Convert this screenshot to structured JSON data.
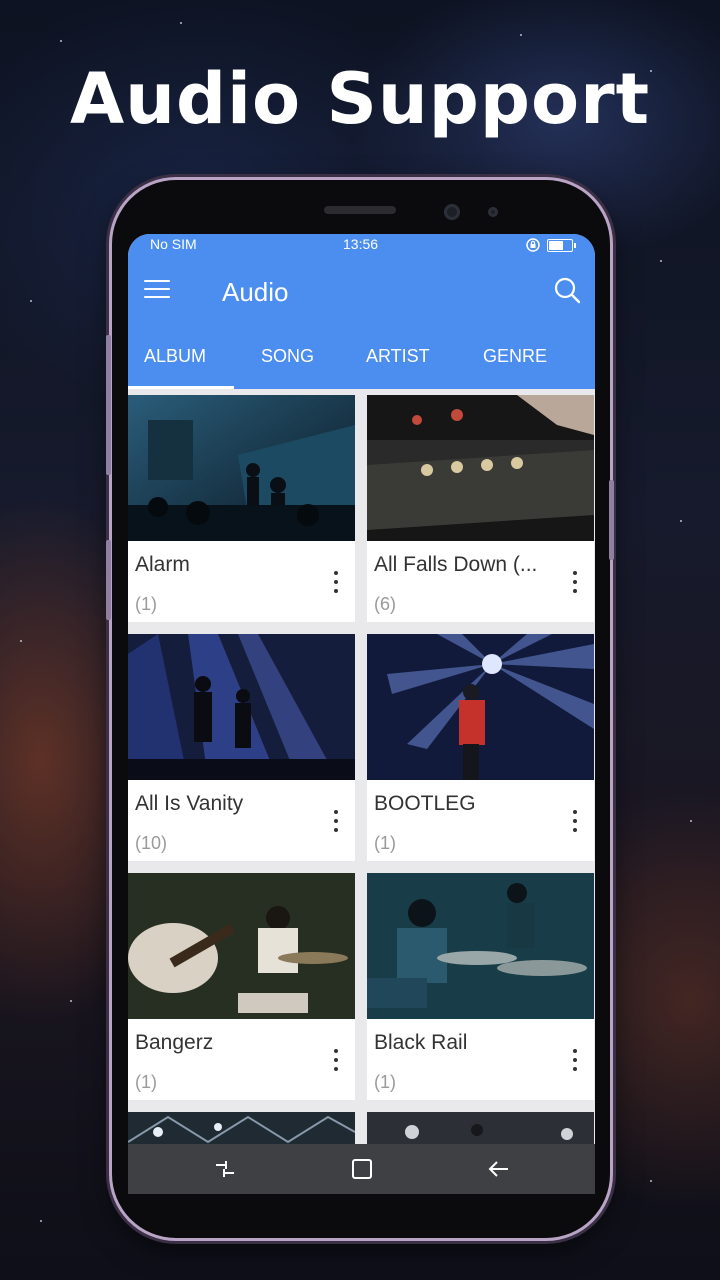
{
  "headline": "Audio Support",
  "status_bar": {
    "carrier": "No SIM",
    "time": "13:56",
    "battery_level": 0.65
  },
  "toolbar": {
    "title": "Audio",
    "menu_icon": "hamburger-menu-icon",
    "search_icon": "search-icon"
  },
  "tabs": [
    {
      "label": "ALBUM",
      "selected": true
    },
    {
      "label": "SONG",
      "selected": false
    },
    {
      "label": "ARTIST",
      "selected": false
    },
    {
      "label": "GENRE",
      "selected": false
    }
  ],
  "albums": [
    {
      "name": "Alarm",
      "count": "(1)"
    },
    {
      "name": "All Falls Down (...",
      "count": "(6)"
    },
    {
      "name": "All Is Vanity",
      "count": "(10)"
    },
    {
      "name": "BOOTLEG",
      "count": "(1)"
    },
    {
      "name": "Bangerz",
      "count": "(1)"
    },
    {
      "name": "Black Rail",
      "count": "(1)"
    }
  ],
  "colors": {
    "accent": "#4c8ef0",
    "nav_bar": "#3f4043",
    "card_bg": "#ffffff",
    "grid_bg": "#e9e9ec"
  },
  "nav_icons": [
    "recent-apps-icon",
    "home-icon",
    "back-icon"
  ]
}
